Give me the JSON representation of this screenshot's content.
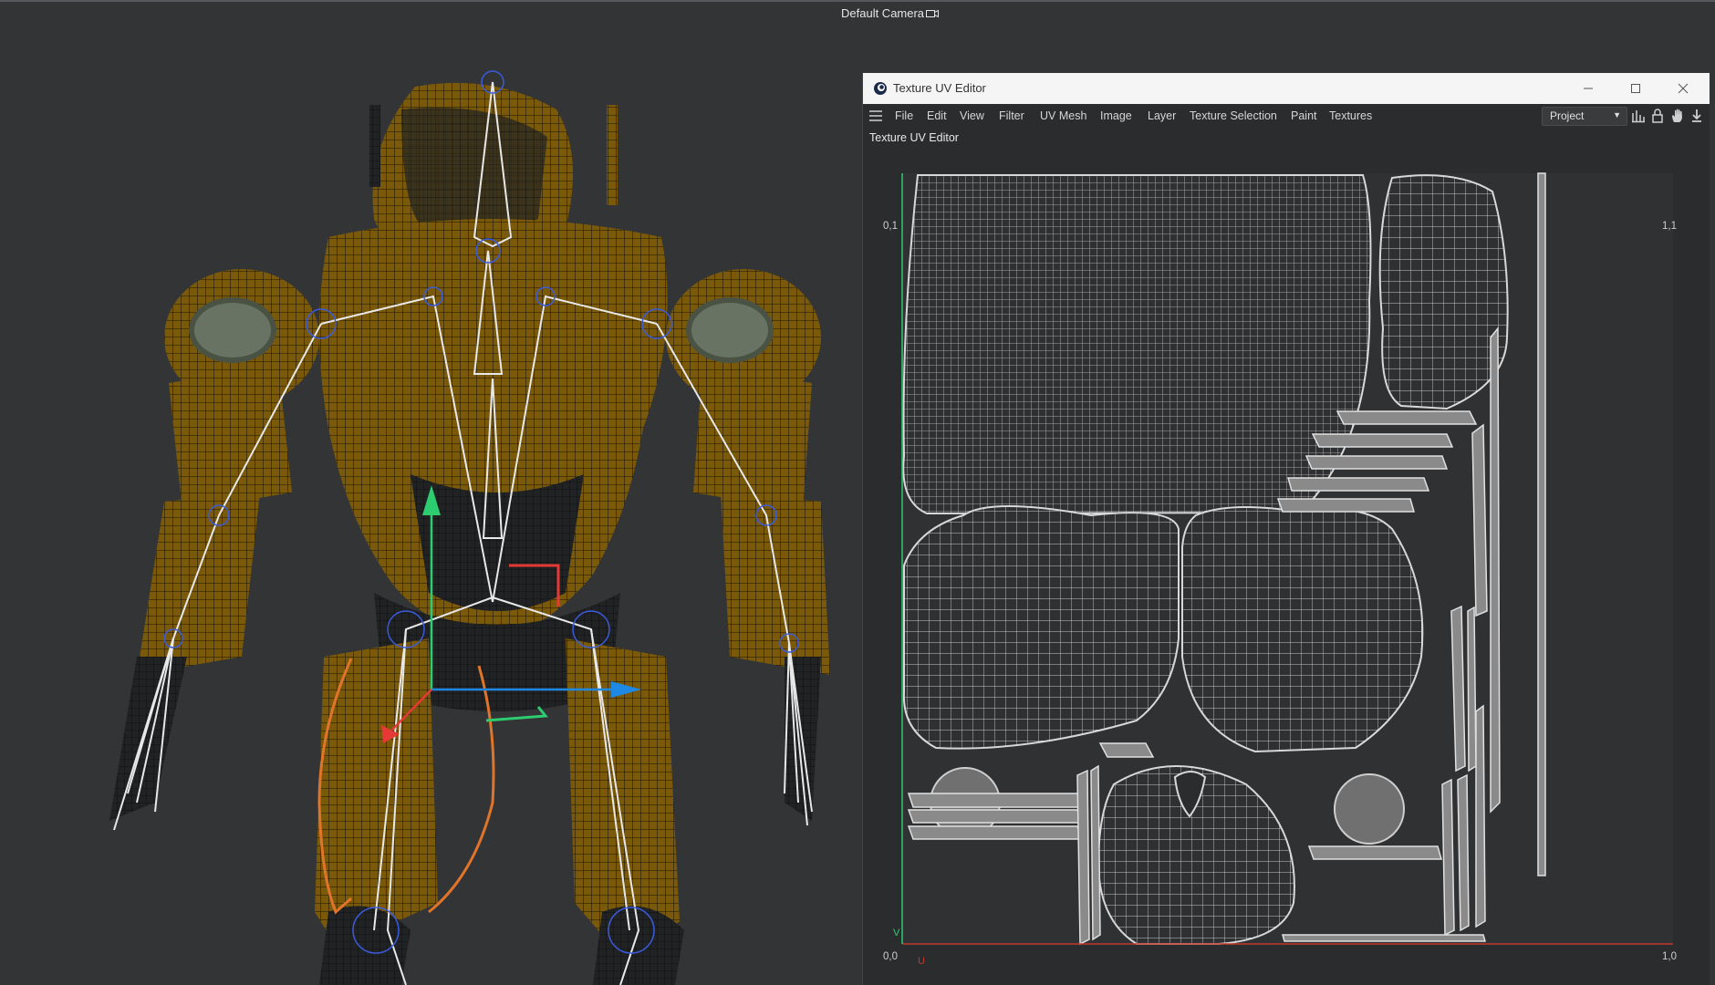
{
  "viewport": {
    "camera_label": "Default Camera",
    "camera_icon": "camera-icon"
  },
  "uv_editor": {
    "window_title": "Texture UV Editor",
    "app_icon": "cinema4d-icon",
    "window_buttons": [
      "minimize-icon",
      "maximize-icon",
      "close-icon"
    ],
    "menu": [
      "File",
      "Edit",
      "View",
      "Filter",
      "UV Mesh",
      "Image",
      "Layer",
      "Texture Selection",
      "Paint",
      "Textures"
    ],
    "mode_select": "Project",
    "toolbar_icons": [
      "histogram-icon",
      "lock-icon",
      "hand-icon",
      "pin-icon"
    ],
    "panel_title": "Texture UV Editor",
    "corners": {
      "top_left": "0,1",
      "top_right": "1,1",
      "bottom_left": "0,0",
      "bottom_right": "1,0"
    },
    "axis_u": "U",
    "axis_v": "V",
    "colors": {
      "u_axis": "#c0392b",
      "v_axis": "#2ecc71",
      "uv_lines": "#c8c8c8"
    }
  },
  "colors": {
    "armor": "#7a5a0a",
    "bone": "#e8e8e8",
    "joint": "#3b5bdb",
    "gizmo_x": "#1e88e5",
    "gizmo_y": "#2ecc71",
    "gizmo_z": "#e53935",
    "selection": "#e0742a"
  }
}
